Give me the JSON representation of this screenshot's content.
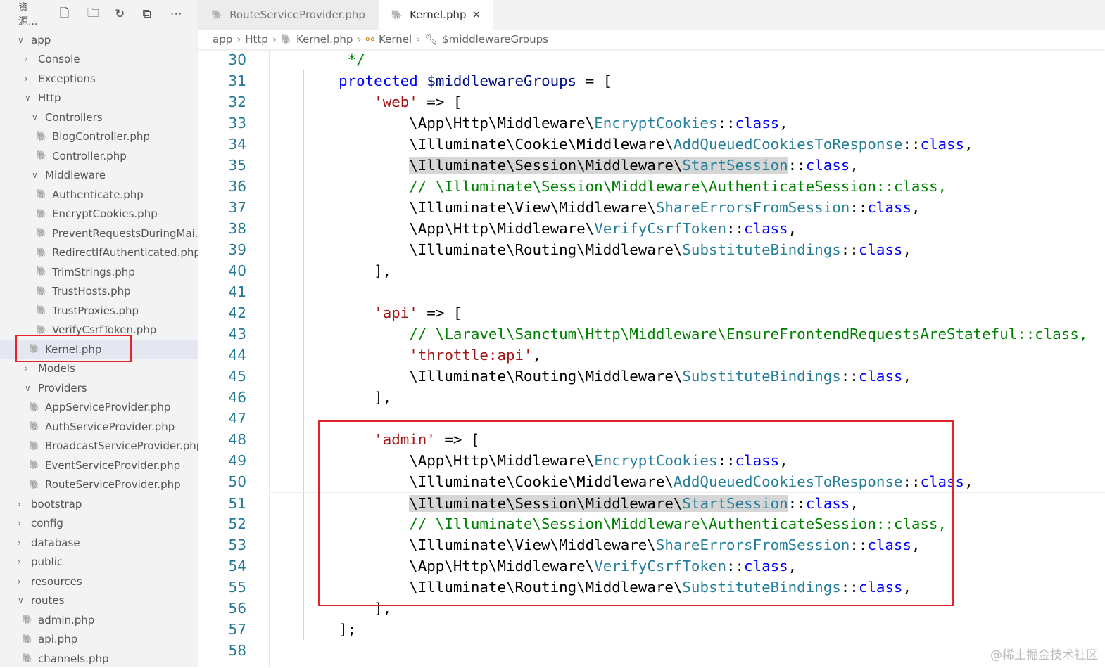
{
  "sidebar": {
    "title": "资源...",
    "toolbar_icons": [
      "new-file-icon",
      "new-folder-icon",
      "refresh-icon",
      "collapse-all-icon",
      "more-icon"
    ],
    "items": [
      {
        "label": "app",
        "type": "folder",
        "open": true,
        "depth": 0
      },
      {
        "label": "Console",
        "type": "folder",
        "open": false,
        "depth": 1
      },
      {
        "label": "Exceptions",
        "type": "folder",
        "open": false,
        "depth": 1
      },
      {
        "label": "Http",
        "type": "folder",
        "open": true,
        "depth": 1
      },
      {
        "label": "Controllers",
        "type": "folder",
        "open": true,
        "depth": 2
      },
      {
        "label": "BlogController.php",
        "type": "file",
        "depth": 3
      },
      {
        "label": "Controller.php",
        "type": "file",
        "depth": 3
      },
      {
        "label": "Middleware",
        "type": "folder",
        "open": true,
        "depth": 2
      },
      {
        "label": "Authenticate.php",
        "type": "file",
        "depth": 3
      },
      {
        "label": "EncryptCookies.php",
        "type": "file",
        "depth": 3
      },
      {
        "label": "PreventRequestsDuringMai...",
        "type": "file",
        "depth": 3
      },
      {
        "label": "RedirectIfAuthenticated.php",
        "type": "file",
        "depth": 3
      },
      {
        "label": "TrimStrings.php",
        "type": "file",
        "depth": 3
      },
      {
        "label": "TrustHosts.php",
        "type": "file",
        "depth": 3
      },
      {
        "label": "TrustProxies.php",
        "type": "file",
        "depth": 3
      },
      {
        "label": "VerifyCsrfToken.php",
        "type": "file",
        "depth": 3
      },
      {
        "label": "Kernel.php",
        "type": "file",
        "depth": 2,
        "selected": true
      },
      {
        "label": "Models",
        "type": "folder",
        "open": false,
        "depth": 1
      },
      {
        "label": "Providers",
        "type": "folder",
        "open": true,
        "depth": 1
      },
      {
        "label": "AppServiceProvider.php",
        "type": "file",
        "depth": 2
      },
      {
        "label": "AuthServiceProvider.php",
        "type": "file",
        "depth": 2
      },
      {
        "label": "BroadcastServiceProvider.php",
        "type": "file",
        "depth": 2
      },
      {
        "label": "EventServiceProvider.php",
        "type": "file",
        "depth": 2
      },
      {
        "label": "RouteServiceProvider.php",
        "type": "file",
        "depth": 2
      },
      {
        "label": "bootstrap",
        "type": "folder",
        "open": false,
        "depth": 0
      },
      {
        "label": "config",
        "type": "folder",
        "open": false,
        "depth": 0
      },
      {
        "label": "database",
        "type": "folder",
        "open": false,
        "depth": 0
      },
      {
        "label": "public",
        "type": "folder",
        "open": false,
        "depth": 0
      },
      {
        "label": "resources",
        "type": "folder",
        "open": false,
        "depth": 0
      },
      {
        "label": "routes",
        "type": "folder",
        "open": true,
        "depth": 0
      },
      {
        "label": "admin.php",
        "type": "file",
        "depth": 1
      },
      {
        "label": "api.php",
        "type": "file",
        "depth": 1
      },
      {
        "label": "channels.php",
        "type": "file",
        "depth": 1
      }
    ]
  },
  "tabs": [
    {
      "label": "RouteServiceProvider.php",
      "active": false
    },
    {
      "label": "Kernel.php",
      "active": true,
      "close": "✕"
    }
  ],
  "breadcrumb": [
    "app",
    "Http",
    "Kernel.php",
    "Kernel",
    "$middlewareGroups"
  ],
  "editor": {
    "current_line": 51,
    "lines": [
      {
        "n": 30,
        "seg": [
          [
            "pl",
            "    "
          ],
          [
            "cm",
            " */"
          ]
        ]
      },
      {
        "n": 31,
        "seg": [
          [
            "pl",
            "    "
          ],
          [
            "kw",
            "protected"
          ],
          [
            "pl",
            " "
          ],
          [
            "var",
            "$middlewareGroups"
          ],
          [
            "pl",
            " = ["
          ]
        ]
      },
      {
        "n": 32,
        "seg": [
          [
            "pl",
            "        "
          ],
          [
            "str",
            "'web'"
          ],
          [
            "pl",
            " => ["
          ]
        ]
      },
      {
        "n": 33,
        "seg": [
          [
            "pl",
            "            \\App\\Http\\Middleware\\"
          ],
          [
            "cls",
            "EncryptCookies"
          ],
          [
            "pl",
            "::"
          ],
          [
            "kw",
            "class"
          ],
          [
            "pl",
            ","
          ]
        ]
      },
      {
        "n": 34,
        "seg": [
          [
            "pl",
            "            \\Illuminate\\Cookie\\Middleware\\"
          ],
          [
            "cls",
            "AddQueuedCookiesToResponse"
          ],
          [
            "pl",
            "::"
          ],
          [
            "kw",
            "class"
          ],
          [
            "pl",
            ","
          ]
        ]
      },
      {
        "n": 35,
        "seg": [
          [
            "pl",
            "            "
          ],
          [
            "hlpl",
            "\\Illuminate\\Session\\Middleware\\"
          ],
          [
            "hlcls",
            "StartSession"
          ],
          [
            "pl",
            "::"
          ],
          [
            "kw",
            "class"
          ],
          [
            "pl",
            ","
          ]
        ]
      },
      {
        "n": 36,
        "seg": [
          [
            "pl",
            "            "
          ],
          [
            "cm",
            "// \\Illuminate\\Session\\Middleware\\AuthenticateSession::class,"
          ]
        ]
      },
      {
        "n": 37,
        "seg": [
          [
            "pl",
            "            \\Illuminate\\View\\Middleware\\"
          ],
          [
            "cls",
            "ShareErrorsFromSession"
          ],
          [
            "pl",
            "::"
          ],
          [
            "kw",
            "class"
          ],
          [
            "pl",
            ","
          ]
        ]
      },
      {
        "n": 38,
        "seg": [
          [
            "pl",
            "            \\App\\Http\\Middleware\\"
          ],
          [
            "cls",
            "VerifyCsrfToken"
          ],
          [
            "pl",
            "::"
          ],
          [
            "kw",
            "class"
          ],
          [
            "pl",
            ","
          ]
        ]
      },
      {
        "n": 39,
        "seg": [
          [
            "pl",
            "            \\Illuminate\\Routing\\Middleware\\"
          ],
          [
            "cls",
            "SubstituteBindings"
          ],
          [
            "pl",
            "::"
          ],
          [
            "kw",
            "class"
          ],
          [
            "pl",
            ","
          ]
        ]
      },
      {
        "n": 40,
        "seg": [
          [
            "pl",
            "        ],"
          ]
        ]
      },
      {
        "n": 41,
        "seg": []
      },
      {
        "n": 42,
        "seg": [
          [
            "pl",
            "        "
          ],
          [
            "str",
            "'api'"
          ],
          [
            "pl",
            " => ["
          ]
        ]
      },
      {
        "n": 43,
        "seg": [
          [
            "pl",
            "            "
          ],
          [
            "cm",
            "// \\Laravel\\Sanctum\\Http\\Middleware\\EnsureFrontendRequestsAreStateful::class,"
          ]
        ]
      },
      {
        "n": 44,
        "seg": [
          [
            "pl",
            "            "
          ],
          [
            "str",
            "'throttle:api'"
          ],
          [
            "pl",
            ","
          ]
        ]
      },
      {
        "n": 45,
        "seg": [
          [
            "pl",
            "            \\Illuminate\\Routing\\Middleware\\"
          ],
          [
            "cls",
            "SubstituteBindings"
          ],
          [
            "pl",
            "::"
          ],
          [
            "kw",
            "class"
          ],
          [
            "pl",
            ","
          ]
        ]
      },
      {
        "n": 46,
        "seg": [
          [
            "pl",
            "        ],"
          ]
        ]
      },
      {
        "n": 47,
        "seg": []
      },
      {
        "n": 48,
        "seg": [
          [
            "pl",
            "        "
          ],
          [
            "str",
            "'admin'"
          ],
          [
            "pl",
            " => ["
          ]
        ]
      },
      {
        "n": 49,
        "seg": [
          [
            "pl",
            "            \\App\\Http\\Middleware\\"
          ],
          [
            "cls",
            "EncryptCookies"
          ],
          [
            "pl",
            "::"
          ],
          [
            "kw",
            "class"
          ],
          [
            "pl",
            ","
          ]
        ]
      },
      {
        "n": 50,
        "seg": [
          [
            "pl",
            "            \\Illuminate\\Cookie\\Middleware\\"
          ],
          [
            "cls",
            "AddQueuedCookiesToResponse"
          ],
          [
            "pl",
            "::"
          ],
          [
            "kw",
            "class"
          ],
          [
            "pl",
            ","
          ]
        ]
      },
      {
        "n": 51,
        "seg": [
          [
            "pl",
            "            "
          ],
          [
            "hlpl",
            "\\Illuminate\\Session\\Middleware\\"
          ],
          [
            "hlcls",
            "StartSession"
          ],
          [
            "pl",
            "::"
          ],
          [
            "kw",
            "class"
          ],
          [
            "pl",
            ","
          ]
        ]
      },
      {
        "n": 52,
        "seg": [
          [
            "pl",
            "            "
          ],
          [
            "cm",
            "// \\Illuminate\\Session\\Middleware\\AuthenticateSession::class,"
          ]
        ]
      },
      {
        "n": 53,
        "seg": [
          [
            "pl",
            "            \\Illuminate\\View\\Middleware\\"
          ],
          [
            "cls",
            "ShareErrorsFromSession"
          ],
          [
            "pl",
            "::"
          ],
          [
            "kw",
            "class"
          ],
          [
            "pl",
            ","
          ]
        ]
      },
      {
        "n": 54,
        "seg": [
          [
            "pl",
            "            \\App\\Http\\Middleware\\"
          ],
          [
            "cls",
            "VerifyCsrfToken"
          ],
          [
            "pl",
            "::"
          ],
          [
            "kw",
            "class"
          ],
          [
            "pl",
            ","
          ]
        ]
      },
      {
        "n": 55,
        "seg": [
          [
            "pl",
            "            \\Illuminate\\Routing\\Middleware\\"
          ],
          [
            "cls",
            "SubstituteBindings"
          ],
          [
            "pl",
            "::"
          ],
          [
            "kw",
            "class"
          ],
          [
            "pl",
            ","
          ]
        ]
      },
      {
        "n": 56,
        "seg": [
          [
            "pl",
            "        ],"
          ]
        ]
      },
      {
        "n": 57,
        "seg": [
          [
            "pl",
            "    ];"
          ]
        ]
      },
      {
        "n": 58,
        "seg": []
      }
    ]
  },
  "watermark": "@稀土掘金技术社区"
}
